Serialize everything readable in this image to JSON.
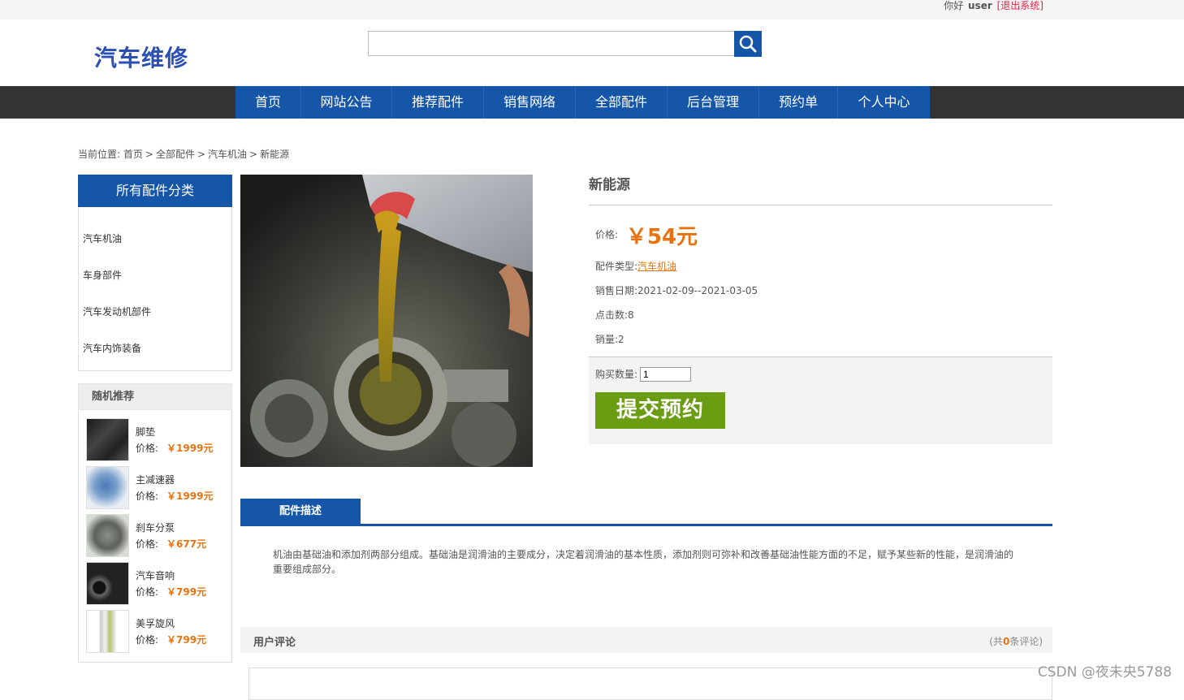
{
  "topbar": {
    "greeting": "你好",
    "username": "user",
    "logout": "[退出系统]"
  },
  "header": {
    "logo": "汽车维修",
    "search_placeholder": ""
  },
  "nav": {
    "items": [
      "首页",
      "网站公告",
      "推荐配件",
      "销售网络",
      "全部配件",
      "后台管理",
      "预约单",
      "个人中心"
    ]
  },
  "breadcrumb": {
    "label": "当前位置:",
    "items": [
      "首页",
      "全部配件",
      "汽车机油",
      "新能源"
    ],
    "sep": ">"
  },
  "sidebar": {
    "category_title": "所有配件分类",
    "categories": [
      "汽车机油",
      "车身部件",
      "汽车发动机部件",
      "汽车内饰装备"
    ],
    "random_title": "随机推荐",
    "price_label": "价格:",
    "random_items": [
      {
        "name": "脚垫",
        "price": "￥1999元"
      },
      {
        "name": "主减速器",
        "price": "￥1999元"
      },
      {
        "name": "刹车分泵",
        "price": "￥677元"
      },
      {
        "name": "汽车音响",
        "price": "￥799元"
      },
      {
        "name": "美孚旋风",
        "price": "￥799元"
      }
    ]
  },
  "product": {
    "name": "新能源",
    "price_label": "价格:",
    "price": "￥54元",
    "type_label": "配件类型:",
    "type": "汽车机油",
    "date_label": "销售日期:",
    "date": "2021-02-09--2021-03-05",
    "clicks_label": "点击数:",
    "clicks": "8",
    "sales_label": "销量:",
    "sales": "2",
    "qty_label": "购买数量:",
    "qty": "1",
    "submit": "提交预约"
  },
  "tabs": {
    "description": "配件描述"
  },
  "description": "机油由基础油和添加剂两部分组成。基础油是润滑油的主要成分，决定着润滑油的基本性质，添加剂则可弥补和改善基础油性能方面的不足，赋予某些新的性能，是润滑油的重要组成部分。",
  "comments": {
    "title": "用户评论",
    "count_prefix": "(共",
    "count": "0",
    "count_suffix": "条评论)"
  },
  "watermark": "CSDN @夜未央5788"
}
